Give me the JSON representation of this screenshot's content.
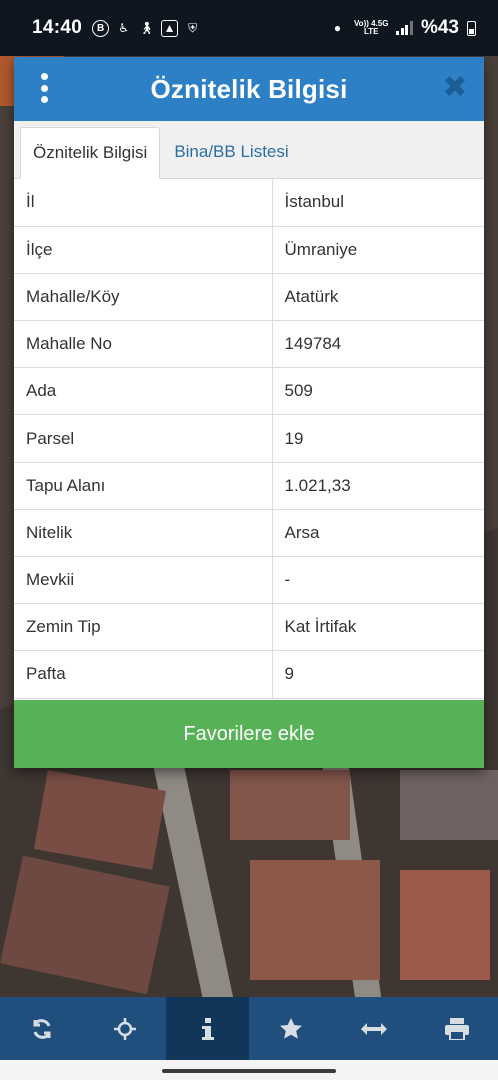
{
  "status_bar": {
    "time": "14:40",
    "network_top": "Vo)) 4.5G",
    "network_bottom": "LTE",
    "battery": "%43"
  },
  "dialog": {
    "title": "Öznitelik Bilgisi",
    "tabs": [
      {
        "label": "Öznitelik Bilgisi"
      },
      {
        "label": "Bina/BB Listesi"
      }
    ],
    "rows": [
      {
        "key": "İl",
        "value": "İstanbul"
      },
      {
        "key": "İlçe",
        "value": "Ümraniye"
      },
      {
        "key": "Mahalle/Köy",
        "value": "Atatürk"
      },
      {
        "key": "Mahalle No",
        "value": "149784"
      },
      {
        "key": "Ada",
        "value": "509"
      },
      {
        "key": "Parsel",
        "value": "19"
      },
      {
        "key": "Tapu Alanı",
        "value": "1.021,33"
      },
      {
        "key": "Nitelik",
        "value": "Arsa"
      },
      {
        "key": "Mevkii",
        "value": "-"
      },
      {
        "key": "Zemin Tip",
        "value": "Kat İrtifak"
      },
      {
        "key": "Pafta",
        "value": "9"
      }
    ],
    "favorite_button": "Favorilere ekle"
  },
  "colors": {
    "header": "#2e80c6",
    "favorite": "#56b157",
    "toolbar": "#214f7d",
    "toolbar_active": "#12365a"
  },
  "toolbar_icons": [
    "refresh-icon",
    "crosshair-icon",
    "info-icon",
    "star-icon",
    "measure-icon",
    "print-icon"
  ]
}
